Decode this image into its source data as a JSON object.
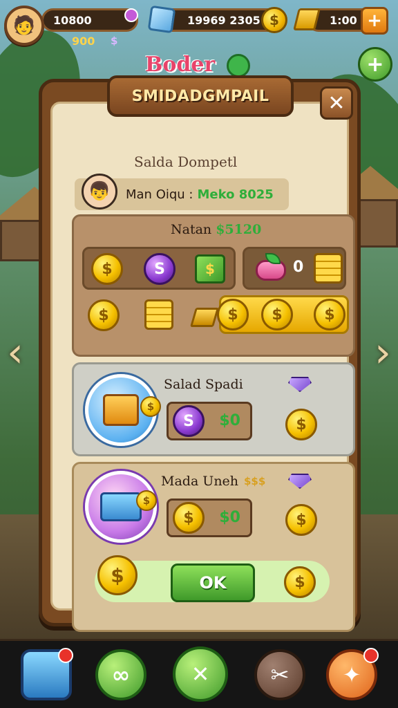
{
  "hud": {
    "coins": "10800",
    "coins_sub": "900",
    "coins_sub_icon": "$",
    "gems": "19969 2305",
    "time": "1:00",
    "plus_label": "+"
  },
  "brand": {
    "text": "Boder"
  },
  "dialog": {
    "title": "SMIDADGMPAIL",
    "close_label": "✕",
    "subtitle": "Salda Dompetl",
    "user_label": "Man Oiqu :",
    "user_value": "Meko 8025"
  },
  "section1": {
    "title_prefix": "Natan",
    "title_value": "$5120",
    "tray_b_value": "0"
  },
  "section2": {
    "title": "Salad Spadi",
    "value": "$0"
  },
  "section3": {
    "title": "Mada Uneh",
    "title_extra": "$$$",
    "value": "$0",
    "ok_label": "OK"
  },
  "icons": {
    "coin_glyph": "$",
    "purple_glyph": "S"
  },
  "arrows": {
    "left": "‹",
    "right": "›"
  },
  "bottom_bar": {
    "btn1": "",
    "btn2": "∞",
    "btn3": "✕",
    "btn4": "✂",
    "btn5": "✦"
  },
  "colors": {
    "accent_green": "#2fae3a",
    "panel_brown": "#7a4a22",
    "title_text": "#ffe9a8"
  }
}
